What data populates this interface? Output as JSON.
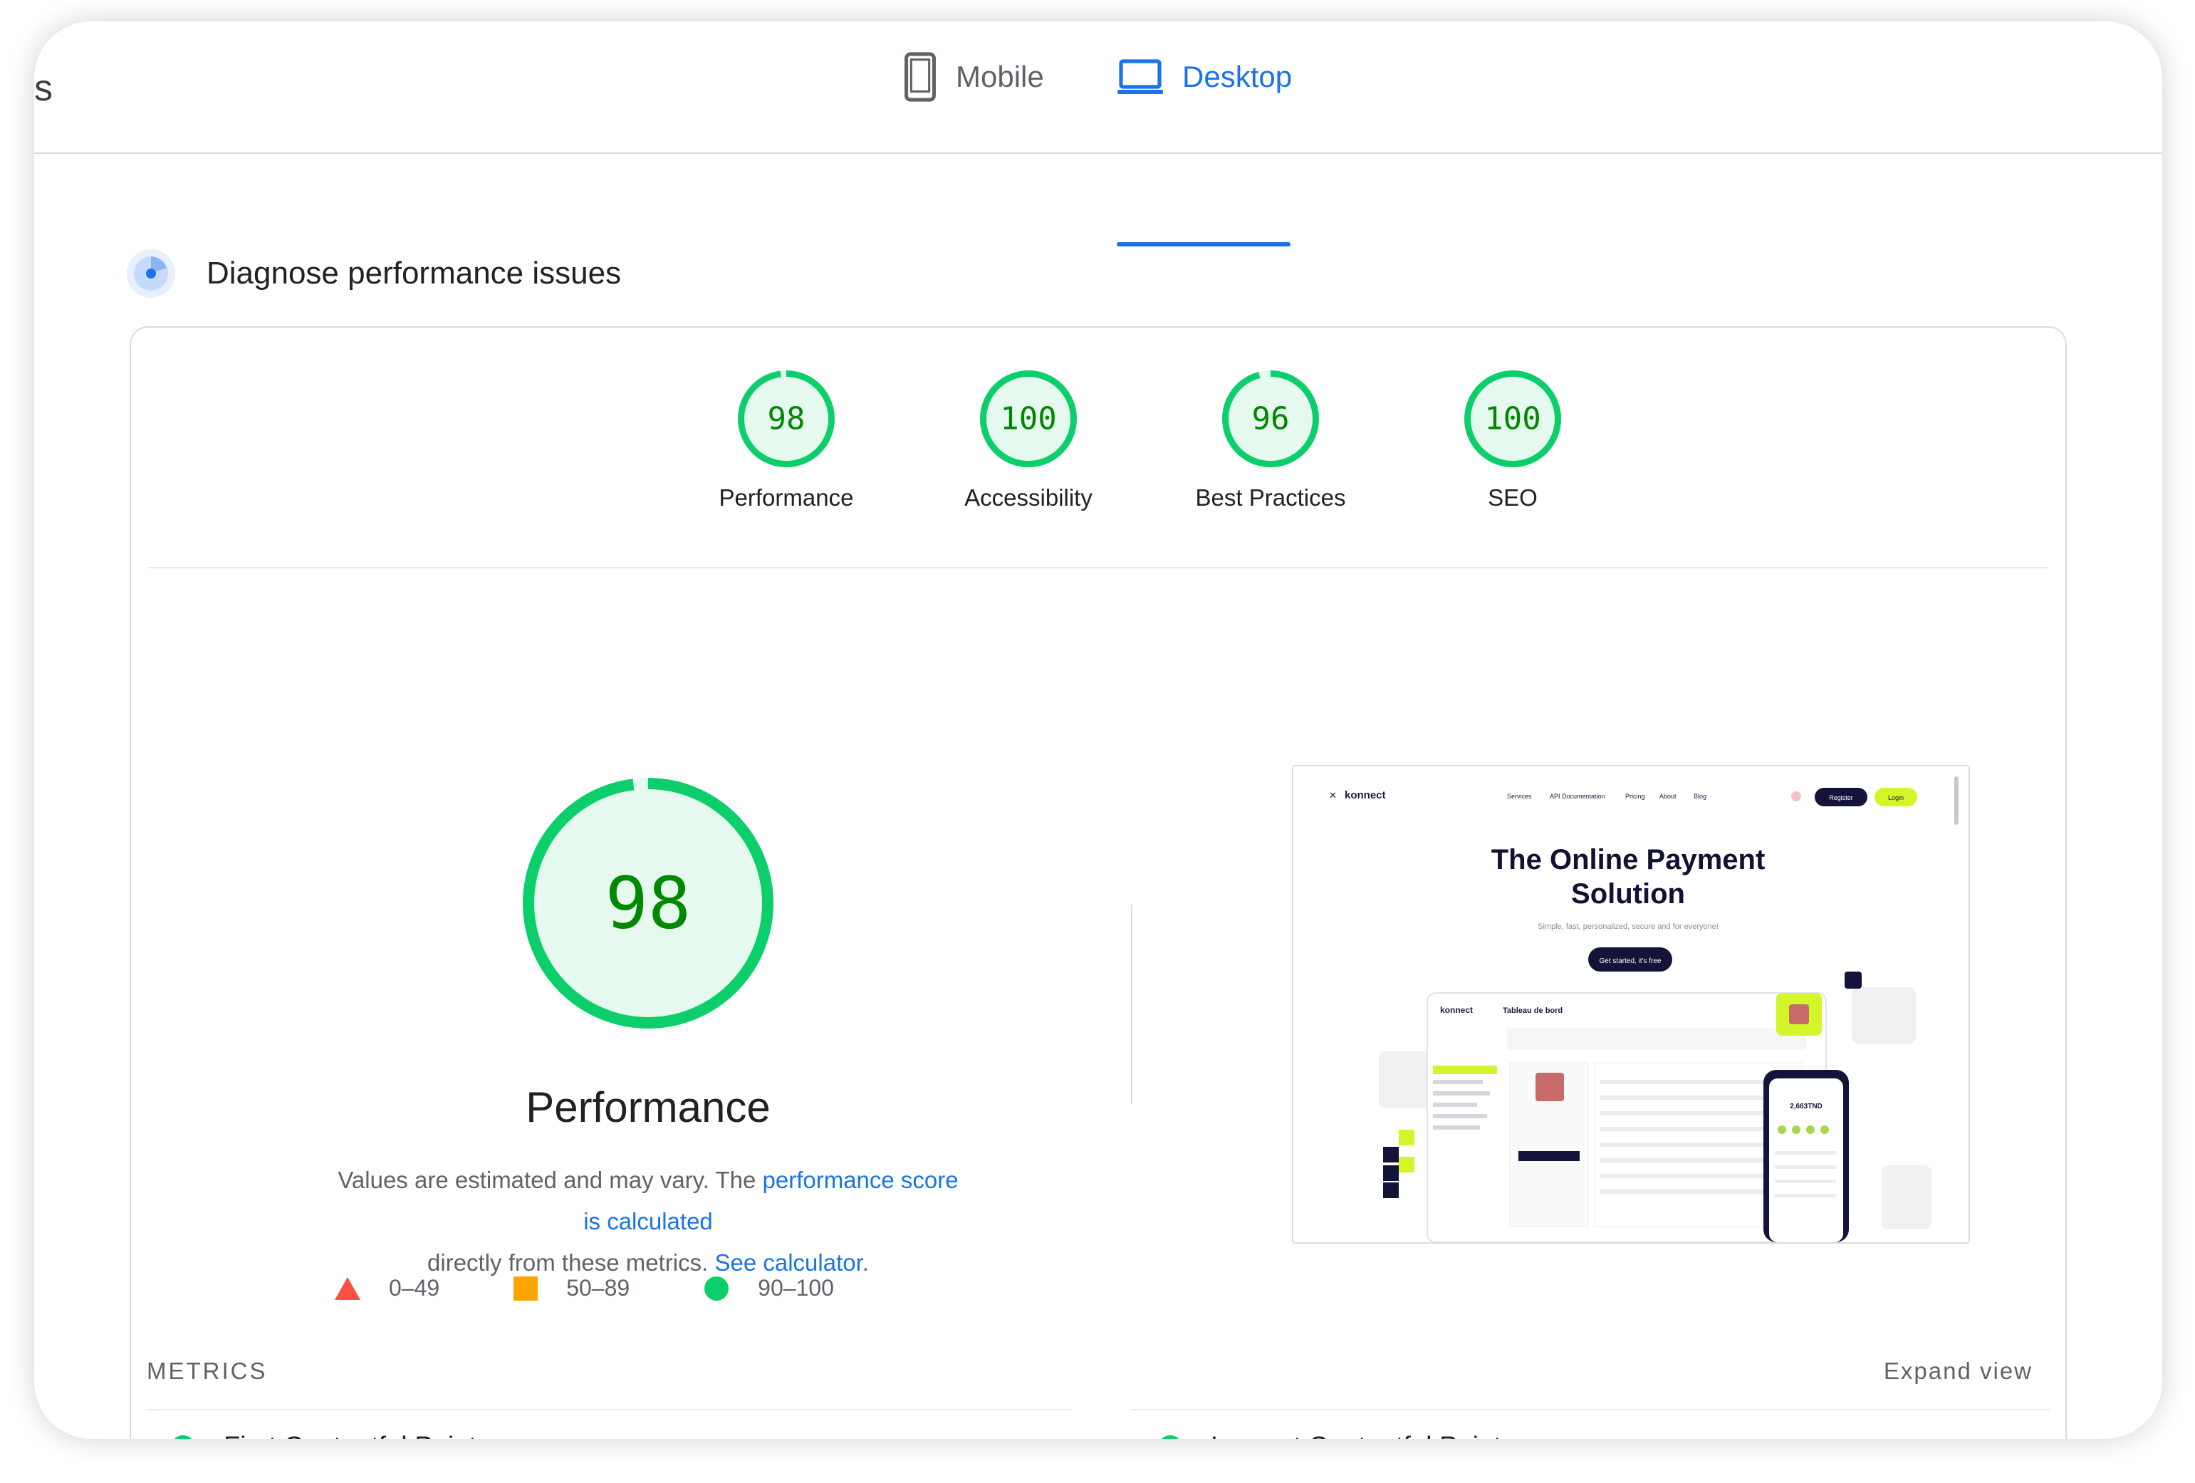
{
  "topbar": {
    "fragment": "s"
  },
  "tabs": {
    "mobile": "Mobile",
    "desktop": "Desktop",
    "active": "desktop"
  },
  "diagnose": {
    "title": "Diagnose performance issues"
  },
  "scores": [
    {
      "label": "Performance",
      "value": "98",
      "score": 98
    },
    {
      "label": "Accessibility",
      "value": "100",
      "score": 100
    },
    {
      "label": "Best Practices",
      "value": "96",
      "score": 96
    },
    {
      "label": "SEO",
      "value": "100",
      "score": 100
    }
  ],
  "performance": {
    "value": "98",
    "score": 98,
    "title": "Performance",
    "desc_prefix": "Values are estimated and may vary. The ",
    "desc_link1": "performance score is calculated",
    "desc_middle": "directly from these metrics. ",
    "desc_link2": "See calculator",
    "desc_suffix": "."
  },
  "legend": {
    "fail": "0–49",
    "average": "50–89",
    "pass": "90–100"
  },
  "metrics": {
    "label": "METRICS",
    "expand": "Expand view",
    "items": [
      "First Contentful Paint",
      "Largest Contentful Paint"
    ]
  },
  "site_preview": {
    "brand": "konnect",
    "nav": [
      "Services",
      "API Documentation",
      "Pricing",
      "About",
      "Blog"
    ],
    "register": "Register",
    "login": "Login",
    "headline_1": "The Online Payment",
    "headline_2": "Solution",
    "tagline": "Simple, fast, personalized, secure and for everyone!",
    "cta": "Get started, it's free",
    "dashboard_title": "Tableau de bord",
    "phone_amount": "2,663TND"
  },
  "colors": {
    "pass": "#0cce6b",
    "pass_text": "#008800",
    "pass_fill": "#e6f9ee",
    "average": "#ffa400",
    "fail": "#ff4e42",
    "link": "#1a73e8"
  }
}
